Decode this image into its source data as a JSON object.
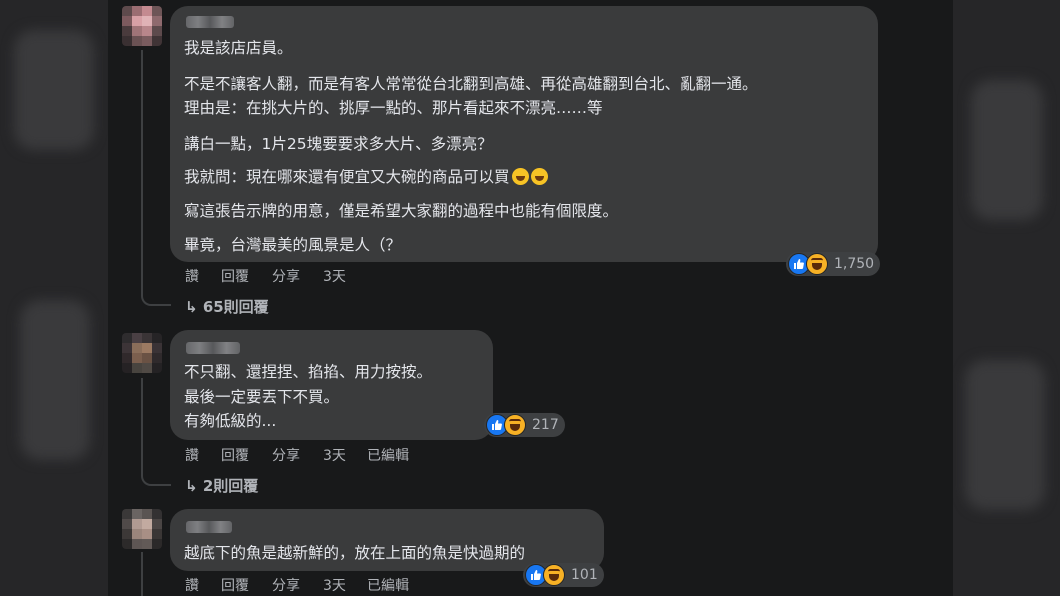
{
  "comments": [
    {
      "lines": [
        "我是該店店員。",
        "不是不讓客人翻，而是有客人常常從台北翻到高雄、再從高雄翻到台北、亂翻一通。",
        "理由是：在挑大片的、挑厚一點的、那片看起來不漂亮……等",
        "講白一點，1片25塊要要求多大片、多漂亮？",
        "我就問：現在哪來還有便宜又大碗的商品可以買",
        "寫這張告示牌的用意，僅是希望大家翻的過程中也能有個限度。",
        "畢竟，台灣最美的風景是人（？"
      ],
      "actions": {
        "like": "讚",
        "reply": "回覆",
        "share": "分享",
        "time": "3天"
      },
      "reaction_count": "1,750",
      "replies": "65則回覆"
    },
    {
      "lines": [
        "不只翻、還捏捏、掐掐、用力按按。",
        "最後一定要丟下不買。",
        "有夠低級的..."
      ],
      "actions": {
        "like": "讚",
        "reply": "回覆",
        "share": "分享",
        "time": "3天",
        "edited": "已編輯"
      },
      "reaction_count": "217",
      "replies": "2則回覆"
    },
    {
      "lines": [
        "越底下的魚是越新鮮的，放在上面的魚是快過期的"
      ],
      "actions": {
        "like": "讚",
        "reply": "回覆",
        "share": "分享",
        "time": "3天",
        "edited": "已編輯"
      },
      "reaction_count": "101"
    }
  ],
  "icons": [
    "like-icon",
    "haha-icon",
    "reply-arrow-icon",
    "grinning-sweat-emoji"
  ],
  "colors": {
    "bubble": "#3a3b3c",
    "background": "#18191a",
    "like_blue": "#1877f2",
    "text": "#e4e6eb",
    "muted": "#b0b3b8"
  }
}
